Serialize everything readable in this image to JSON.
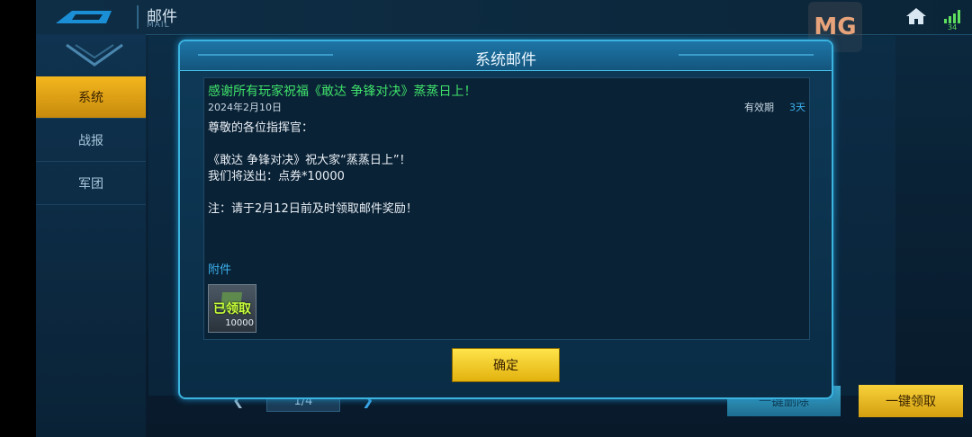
{
  "app": {
    "title_cn": "邮件",
    "title_en": "MAIL",
    "watermark": "MG",
    "signal_value": "34"
  },
  "sidebar": {
    "items": [
      {
        "label": "系统",
        "active": true
      },
      {
        "label": "战报",
        "active": false
      },
      {
        "label": "军团",
        "active": false
      }
    ]
  },
  "pager": {
    "text": "1/4"
  },
  "bottom_buttons": {
    "delete_all": "一键删除",
    "claim_all": "一键领取"
  },
  "dialog": {
    "title": "系统邮件",
    "subject": "感谢所有玩家祝福《敢达 争锋对决》蒸蒸日上！",
    "date": "2024年2月10日",
    "validity_label": "有效期",
    "validity_value": "3天",
    "body": [
      "尊敬的各位指挥官：",
      "《敢达 争锋对决》祝大家“蒸蒸日上”！",
      "我们将送出：点券*10000",
      "注：请于2月12日前及时领取邮件奖励！"
    ],
    "attachment_label": "附件",
    "attachment": {
      "status": "已领取",
      "quantity": "10000"
    },
    "confirm": "确定"
  },
  "colors": {
    "accent_yellow": "#f3b61e",
    "subject_green": "#3fe26a",
    "link_blue": "#3ab0ec",
    "frame": "#3cb4e0"
  }
}
